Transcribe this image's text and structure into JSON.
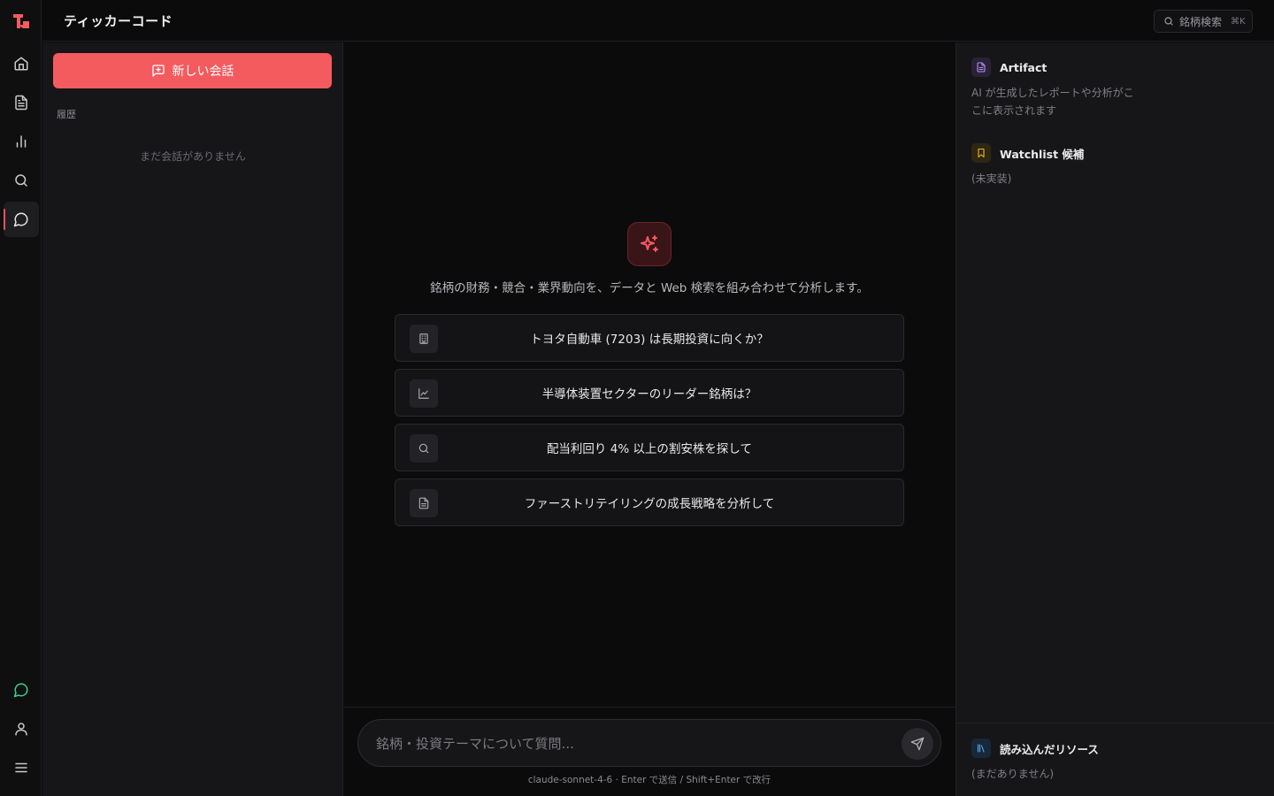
{
  "app": {
    "title": "ティッカーコード",
    "accent": "#f45b5f"
  },
  "search": {
    "label": "銘柄検索",
    "shortcut": "⌘K"
  },
  "rail": {
    "top_items": [
      "home-icon",
      "document-icon",
      "chart-icon",
      "search-icon",
      "chat-icon"
    ],
    "bottom_items": [
      "chat-icon",
      "user-icon",
      "menu-icon"
    ]
  },
  "sidebar": {
    "new_chat_label": "新しい会話",
    "history_label": "履歴",
    "empty_history": "まだ会話がありません"
  },
  "main": {
    "intro": "銘柄の財務・競合・業界動向を、データと Web 検索を組み合わせて分析します。",
    "suggestions": [
      {
        "icon": "building-icon",
        "label": "トヨタ自動車 (7203) は長期投資に向くか？"
      },
      {
        "icon": "line-chart-icon",
        "label": "半導体装置セクターのリーダー銘柄は？"
      },
      {
        "icon": "search-icon",
        "label": "配当利回り 4% 以上の割安株を探して"
      },
      {
        "icon": "document-icon",
        "label": "ファーストリテイリングの成長戦略を分析して"
      }
    ],
    "composer_placeholder": "銘柄・投資テーマについて質問...",
    "hint": "claude-sonnet-4-6 · Enter で送信 / Shift+Enter で改行"
  },
  "right_panel": {
    "artifact": {
      "title": "Artifact",
      "desc": "AI が生成したレポートや分析がここに表示されます"
    },
    "watchlist": {
      "title": "Watchlist 候補",
      "desc": "(未実装)"
    },
    "resources": {
      "title": "読み込んだリソース",
      "desc": "(まだありません)"
    }
  }
}
